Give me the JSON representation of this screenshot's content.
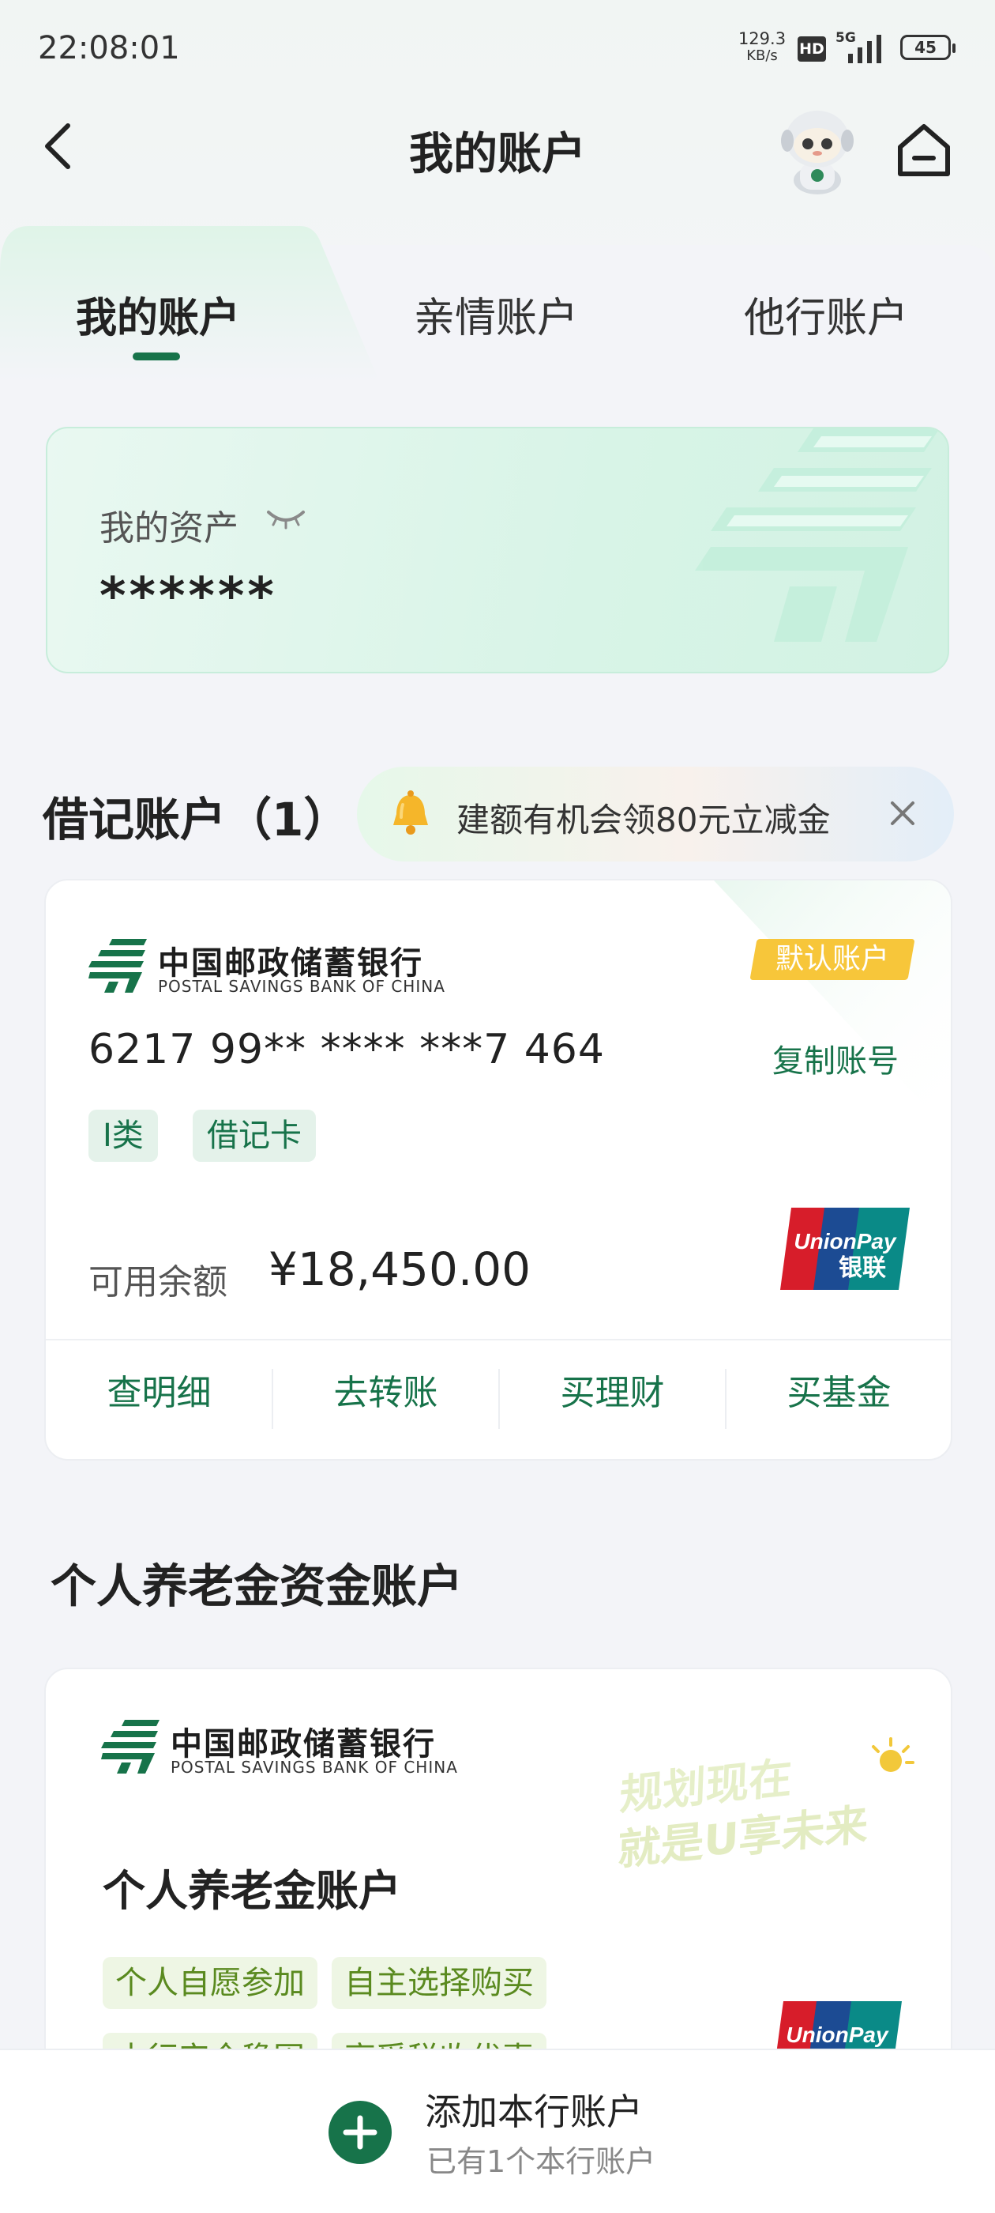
{
  "status_bar": {
    "time": "22:08:01",
    "net_speed": "129.3",
    "net_unit": "KB/s",
    "hd": "HD",
    "network": "5G",
    "battery": "45"
  },
  "header": {
    "title": "我的账户"
  },
  "tabs": [
    {
      "label": "我的账户",
      "active": true
    },
    {
      "label": "亲情账户",
      "active": false
    },
    {
      "label": "他行账户",
      "active": false
    }
  ],
  "assets": {
    "label": "我的资产",
    "value": "******"
  },
  "debit_section": {
    "title": "借记账户（1）",
    "promo_text": "建额有机会领80元立减金"
  },
  "debit_card": {
    "bank_name_cn": "中国邮政储蓄银行",
    "bank_name_en": "POSTAL SAVINGS BANK OF CHINA",
    "default_badge": "默认账户",
    "card_number": "6217 99** **** ***7 464",
    "copy_label": "复制账号",
    "tags": [
      "I类",
      "借记卡"
    ],
    "balance_label": "可用余额",
    "balance_value": "¥18,450.00",
    "unionpay_en": "UnionPay",
    "unionpay_cn": "银联",
    "actions": [
      "查明细",
      "去转账",
      "买理财",
      "买基金"
    ]
  },
  "pension_section": {
    "title": "个人养老金资金账户"
  },
  "pension_card": {
    "bank_name_cn": "中国邮政储蓄银行",
    "bank_name_en": "POSTAL SAVINGS BANK OF CHINA",
    "slogan_line1": "规划现在",
    "slogan_line2": "就是U享未来",
    "account_name": "个人养老金账户",
    "tags": [
      "个人自愿参加",
      "自主选择购买",
      "本行安全稳固",
      "享受税收优惠"
    ]
  },
  "bottom_bar": {
    "add_label": "添加本行账户",
    "add_sub": "已有1个本行账户"
  },
  "colors": {
    "brand_green": "#17734a",
    "badge_yellow": "#f7c63a",
    "asset_card_bg": "#d8f4e7"
  }
}
